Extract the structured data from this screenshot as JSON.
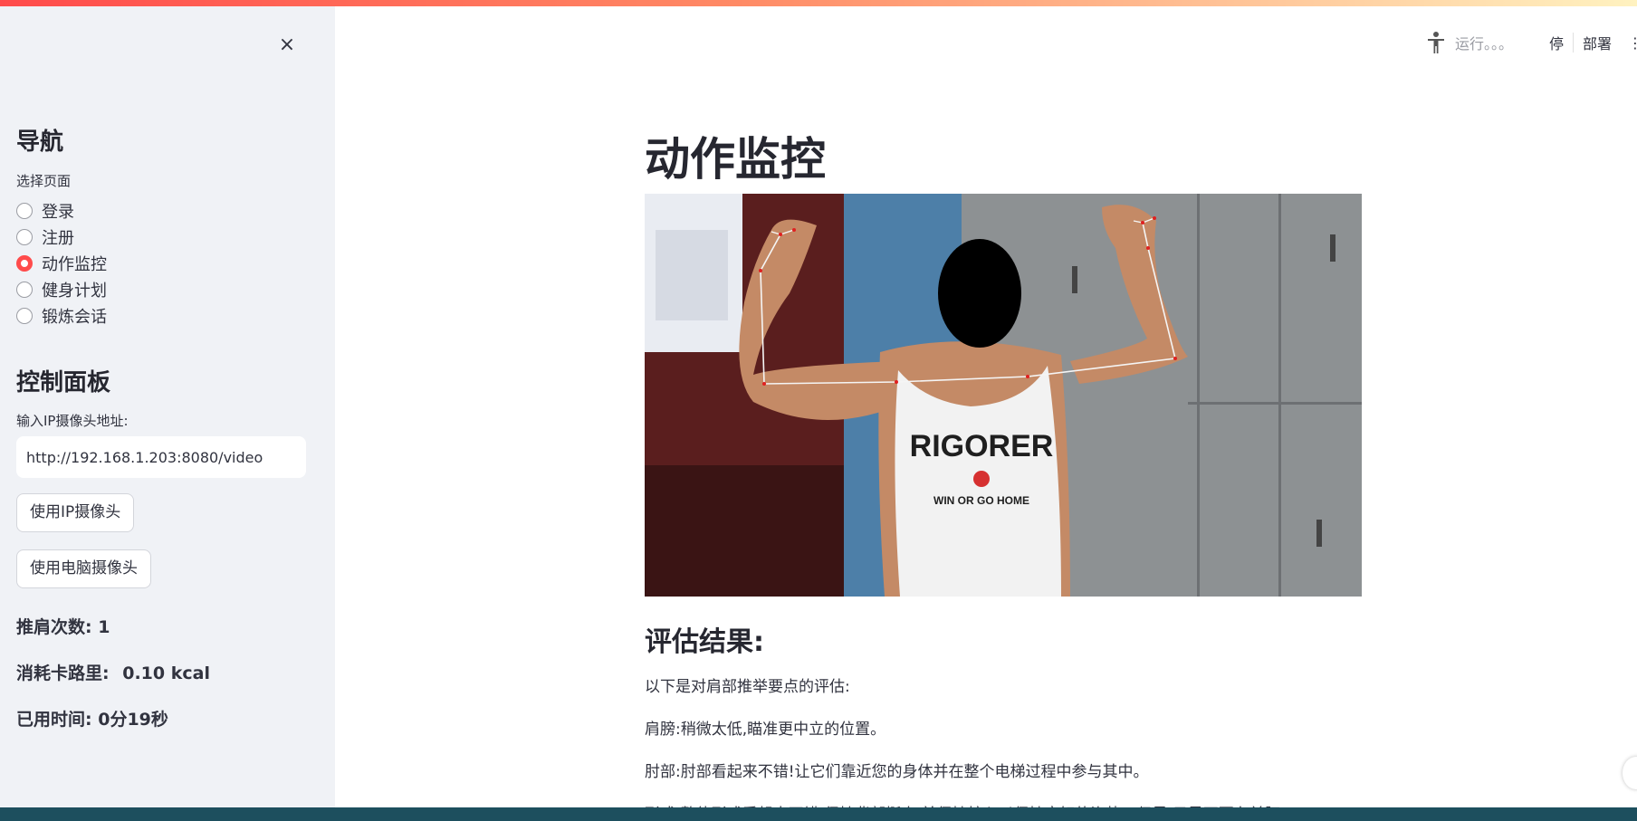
{
  "sidebar": {
    "close_label": "×",
    "nav_title": "导航",
    "select_label": "选择页面",
    "pages": [
      {
        "label": "登录",
        "selected": false
      },
      {
        "label": "注册",
        "selected": false
      },
      {
        "label": "动作监控",
        "selected": true
      },
      {
        "label": "健身计划",
        "selected": false
      },
      {
        "label": "锻炼会话",
        "selected": false
      }
    ],
    "control_title": "控制面板",
    "ip_label": "输入IP摄像头地址:",
    "ip_value": "http://192.168.1.203:8080/video",
    "ip_button": "使用IP摄像头",
    "pc_button": "使用电脑摄像头",
    "stats": {
      "reps_label": "推肩次数:",
      "reps_value": "1",
      "calories_label": "消耗卡路里:",
      "calories_value": "0.10 kcal",
      "time_label": "已用时间:",
      "time_value": "0分19秒"
    }
  },
  "toolbar": {
    "running_text": "运行。。。",
    "stop_label": "停",
    "deploy_label": "部署",
    "menu_label": "⋮"
  },
  "main": {
    "title": "动作监控",
    "photo": {
      "shirt_text": "RIGORER",
      "shirt_slogan": "WIN OR GO HOME"
    },
    "result_title": "评估结果:",
    "intro": "以下是对肩部推举要点的评估:",
    "shoulder": "肩膀:稍微太低,瞄准更中立的位置。",
    "elbow": "肘部:肘部看起来不错!让它们靠近您的身体并在整个电梯过程中参与其中。",
    "form_partial": "形式:整体形式看起来不错,保持背部挺直,并保持核心以保持良好的姿势。但是,只是不要在前胚"
  },
  "colors": {
    "accent": "#ff4b4b",
    "sidebar_bg": "#f0f2f6",
    "taskbar": "#1d4f5e"
  }
}
